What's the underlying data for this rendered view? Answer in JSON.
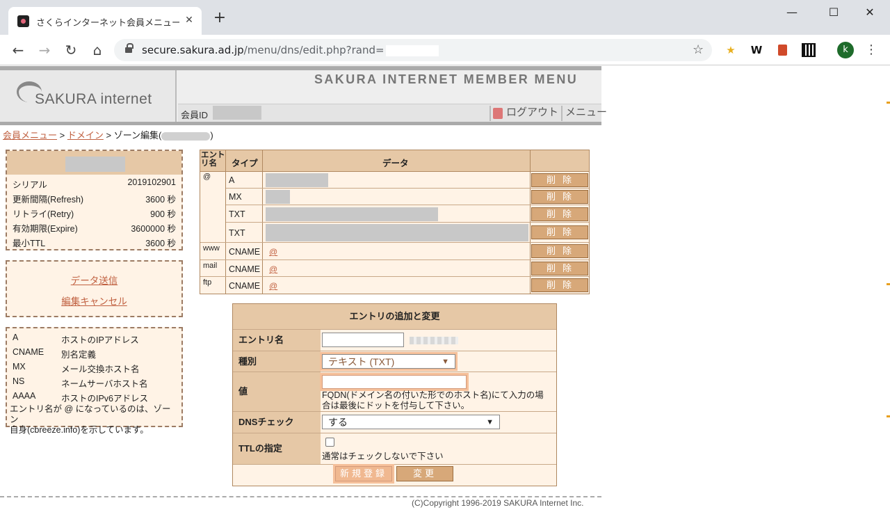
{
  "browser": {
    "tab_title": "さくらインターネット会員メニュー - ゾーン",
    "tab_close": "✕",
    "new_tab": "+",
    "win_minimize": "—",
    "win_maximize": "☐",
    "win_close": "✕",
    "nav_back": "←",
    "nav_forward": "→",
    "nav_reload": "↻",
    "nav_home": "⌂",
    "url_host": "secure.sakura.ad.jp",
    "url_path": "/menu/dns/edit.php?rand=",
    "bookmark_star": "☆",
    "ext_star": "★",
    "ext_w": "W",
    "avatar_letter": "k",
    "menu": "⋮"
  },
  "header": {
    "logo_text": "SAKURA internet",
    "title": "SAKURA INTERNET MEMBER MENU",
    "member_id_label": "会員ID",
    "logout": "ログアウト",
    "menu": "メニュー"
  },
  "breadcrumb": {
    "home": "会員メニュー",
    "sep1": " > ",
    "domain": "ドメイン",
    "sep2": " > ",
    "current": "ゾーン編集(",
    "close_paren": ")"
  },
  "soa": {
    "rows": [
      {
        "label": "シリアル",
        "value": "2019102901"
      },
      {
        "label": "更新間隔(Refresh)",
        "value": "3600 秒"
      },
      {
        "label": "リトライ(Retry)",
        "value": "900 秒"
      },
      {
        "label": "有効期限(Expire)",
        "value": "3600000 秒"
      },
      {
        "label": "最小TTL",
        "value": "3600 秒"
      }
    ]
  },
  "actions": {
    "send": "データ送信",
    "cancel": "編集キャンセル"
  },
  "legend": {
    "rows": [
      {
        "type": "A",
        "desc": "ホストのIPアドレス"
      },
      {
        "type": "CNAME",
        "desc": "別名定義"
      },
      {
        "type": "MX",
        "desc": "メール交換ホスト名"
      },
      {
        "type": "NS",
        "desc": "ネームサーバホスト名"
      },
      {
        "type": "AAAA",
        "desc": "ホストのIPv6アドレス"
      }
    ],
    "note_line1": "エントリ名が @ になっているのは、ゾーン",
    "note_line2": "自身(cbreeze.info)を示しています。"
  },
  "records": {
    "headers": {
      "entry_1": "エント",
      "entry_2": "リ名",
      "type": "タイプ",
      "data": "データ"
    },
    "delete_label": "削除",
    "rows": [
      {
        "entry": "@",
        "type": "A",
        "data": ""
      },
      {
        "entry": "",
        "type": "MX",
        "data": ""
      },
      {
        "entry": "",
        "type": "TXT",
        "data": ""
      },
      {
        "entry": "",
        "type": "TXT",
        "data": ""
      },
      {
        "entry": "www",
        "type": "CNAME",
        "data": "@"
      },
      {
        "entry": "mail",
        "type": "CNAME",
        "data": "@"
      },
      {
        "entry": "ftp",
        "type": "CNAME",
        "data": "@"
      }
    ]
  },
  "form": {
    "title": "エントリの追加と変更",
    "entry_label": "エントリ名",
    "entry_value": "",
    "type_label": "種別",
    "type_value": "テキスト (TXT)",
    "value_label": "値",
    "value_value": "",
    "value_hint_1": "FQDN(ドメイン名の付いた形でのホスト名)にて入力の場",
    "value_hint_2": "合は最後にドットを付与して下さい。",
    "dns_label": "DNSチェック",
    "dns_value": "する",
    "ttl_label": "TTLの指定",
    "ttl_checked": false,
    "ttl_hint": "通常はチェックしないで下さい",
    "register_button": "新規登録",
    "change_button": "変更"
  },
  "footer": {
    "copyright": "(C)Copyright 1996-2019 SAKURA Internet Inc."
  },
  "colors": {
    "accent_link": "#c06040",
    "panel_bg": "#fff3e6",
    "panel_head": "#e6c8a6",
    "button": "#d7a879"
  }
}
